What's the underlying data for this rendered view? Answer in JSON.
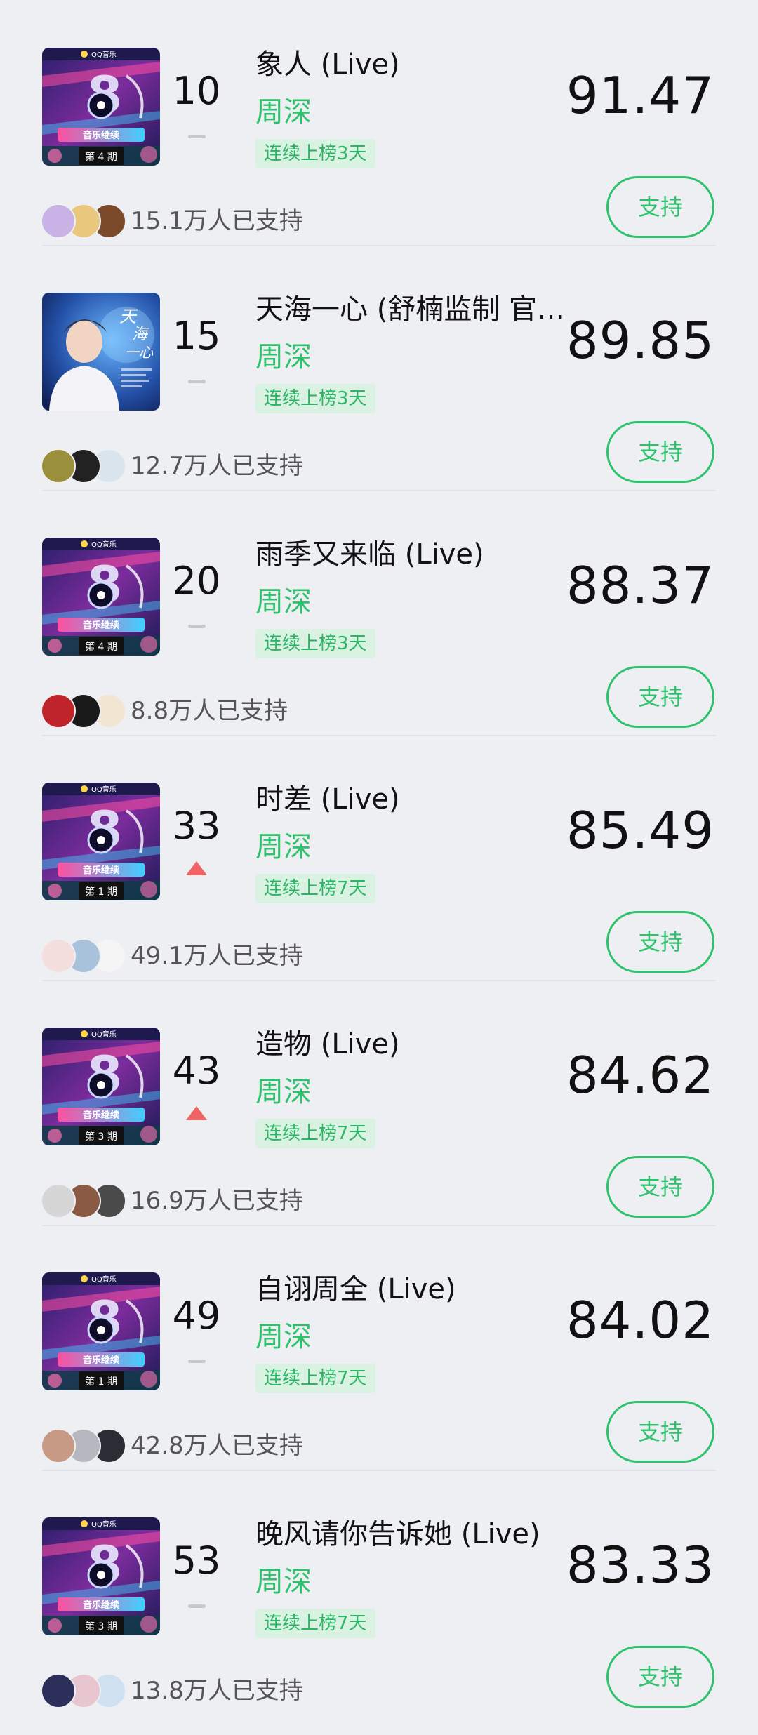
{
  "support_label": "支持",
  "items": [
    {
      "rank": "10",
      "trend": "flat",
      "title": "象人 (Live)",
      "artist": "周深",
      "tag": "连续上榜3天",
      "score": "91.47",
      "supporters": "15.1万人已支持",
      "cover": {
        "type": "stage",
        "issue": "第 4 期"
      },
      "avatar_colors": [
        "#c9b3e6",
        "#e9c77d",
        "#7b4a2a"
      ]
    },
    {
      "rank": "15",
      "trend": "flat",
      "title": "天海一心 (舒楠监制 官…",
      "artist": "周深",
      "tag": "连续上榜3天",
      "score": "89.85",
      "supporters": "12.7万人已支持",
      "cover": {
        "type": "portrait",
        "text": "天海一心"
      },
      "avatar_colors": [
        "#9a8f3a",
        "#222222",
        "#d9e4ec"
      ]
    },
    {
      "rank": "20",
      "trend": "flat",
      "title": "雨季又来临 (Live)",
      "artist": "周深",
      "tag": "连续上榜3天",
      "score": "88.37",
      "supporters": "8.8万人已支持",
      "cover": {
        "type": "stage",
        "issue": "第 4 期"
      },
      "avatar_colors": [
        "#c0242b",
        "#1a1a1a",
        "#f1e6d2"
      ]
    },
    {
      "rank": "33",
      "trend": "up",
      "title": "时差 (Live)",
      "artist": "周深",
      "tag": "连续上榜7天",
      "score": "85.49",
      "supporters": "49.1万人已支持",
      "cover": {
        "type": "stage",
        "issue": "第 1 期"
      },
      "avatar_colors": [
        "#f4dede",
        "#a9c2dc",
        "#f5f5f5"
      ]
    },
    {
      "rank": "43",
      "trend": "up",
      "title": "造物 (Live)",
      "artist": "周深",
      "tag": "连续上榜7天",
      "score": "84.62",
      "supporters": "16.9万人已支持",
      "cover": {
        "type": "stage",
        "issue": "第 3 期"
      },
      "avatar_colors": [
        "#d6d6d6",
        "#8a5a44",
        "#4a4a4a"
      ]
    },
    {
      "rank": "49",
      "trend": "flat",
      "title": "自诩周全 (Live)",
      "artist": "周深",
      "tag": "连续上榜7天",
      "score": "84.02",
      "supporters": "42.8万人已支持",
      "cover": {
        "type": "stage",
        "issue": "第 1 期"
      },
      "avatar_colors": [
        "#c79a86",
        "#b7b7c0",
        "#2a2d33"
      ]
    },
    {
      "rank": "53",
      "trend": "flat",
      "title": "晚风请你告诉她 (Live)",
      "artist": "周深",
      "tag": "连续上榜7天",
      "score": "83.33",
      "supporters": "13.8万人已支持",
      "cover": {
        "type": "stage",
        "issue": "第 3 期"
      },
      "avatar_colors": [
        "#2b2f5a",
        "#e8c6cf",
        "#cfe0f0"
      ]
    }
  ]
}
